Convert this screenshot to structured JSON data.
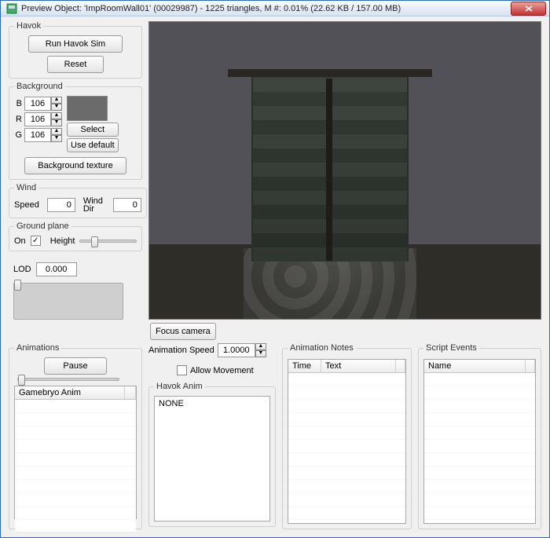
{
  "window": {
    "title": "Preview Object: 'ImpRoomWall01' (00029987) - 1225 triangles, M #: 0.01% (22.62 KB / 157.00 MB)"
  },
  "havok": {
    "legend": "Havok",
    "run": "Run Havok Sim",
    "reset": "Reset"
  },
  "background": {
    "legend": "Background",
    "b_label": "B",
    "r_label": "R",
    "g_label": "G",
    "b": "106",
    "r": "106",
    "g": "106",
    "select": "Select",
    "use_default": "Use default",
    "texture": "Background texture"
  },
  "wind": {
    "legend": "Wind",
    "speed_label": "Speed",
    "speed": "0",
    "dir_label": "Wind Dir",
    "dir": "0"
  },
  "ground": {
    "legend": "Ground plane",
    "on_label": "On",
    "on_checked": "✓",
    "height_label": "Height"
  },
  "lod": {
    "label": "LOD",
    "value": "0.000"
  },
  "focus": "Focus camera",
  "animations": {
    "legend": "Animations",
    "pause": "Pause",
    "gamebryo_col": "Gamebryo Anim",
    "speed_label": "Animation Speed",
    "speed": "1.0000",
    "allow": "Allow Movement",
    "havok_legend": "Havok Anim",
    "havok_value": "NONE"
  },
  "notes": {
    "legend": "Animation Notes",
    "col1": "Time",
    "col2": "Text"
  },
  "events": {
    "legend": "Script Events",
    "col1": "Name"
  }
}
